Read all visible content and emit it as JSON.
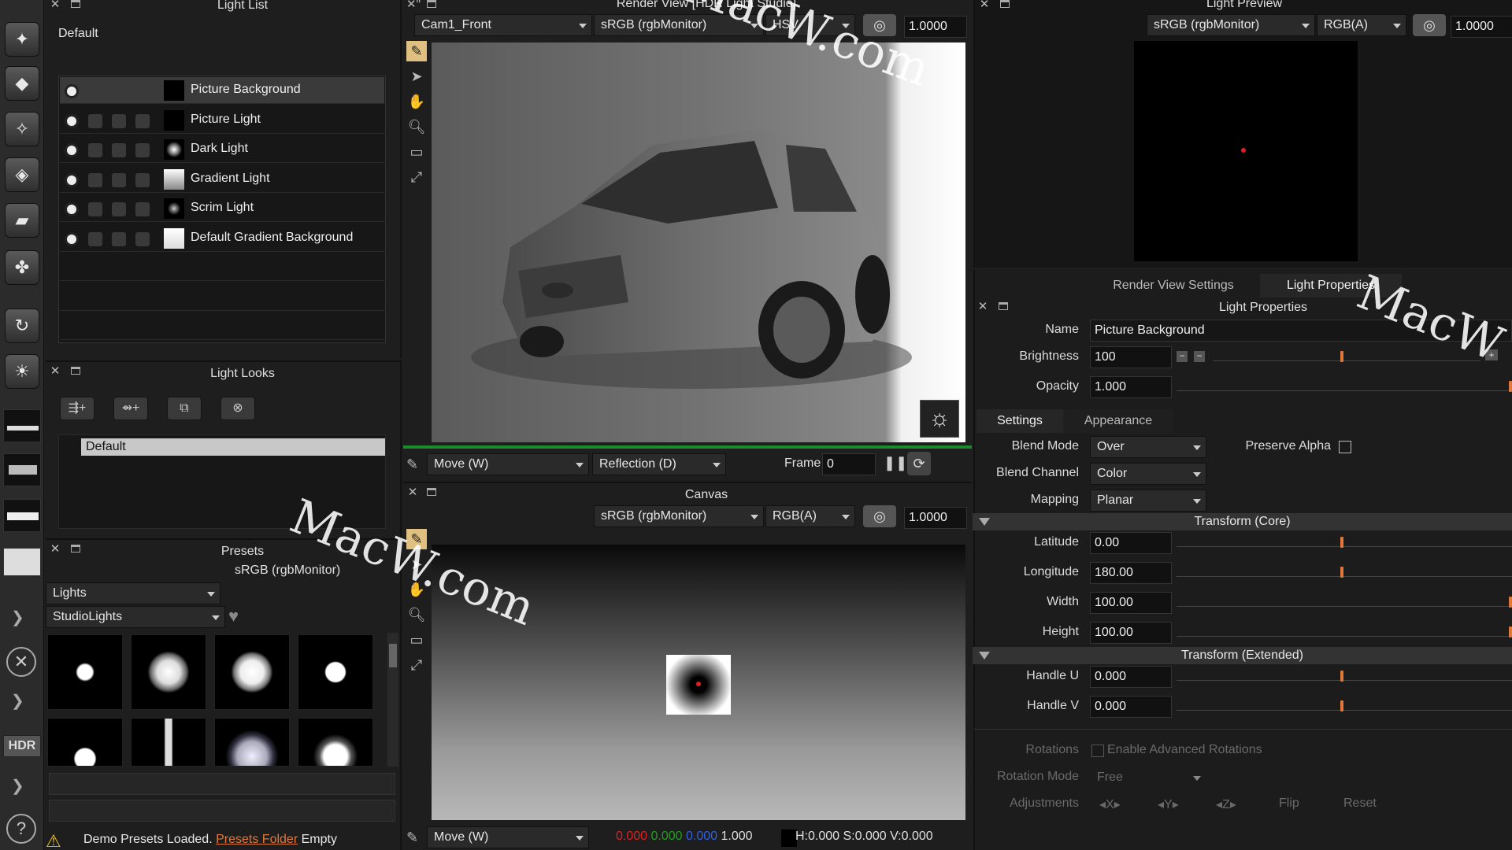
{
  "light_list": {
    "title": "Light List",
    "group": "Default",
    "items": [
      {
        "name": "Picture Background",
        "thumb": "black",
        "selected": true
      },
      {
        "name": "Picture Light",
        "thumb": "black"
      },
      {
        "name": "Dark Light",
        "thumb": "radial"
      },
      {
        "name": "Gradient Light",
        "thumb": "gradient"
      },
      {
        "name": "Scrim Light",
        "thumb": "dot"
      },
      {
        "name": "Default Gradient Background",
        "thumb": "white"
      }
    ]
  },
  "light_looks": {
    "title": "Light Looks",
    "item": "Default"
  },
  "presets": {
    "title": "Presets",
    "color_space": "sRGB (rgbMonitor)",
    "category": "Lights",
    "library": "StudioLights",
    "status_text": "Demo Presets Loaded.",
    "status_link": "Presets Folder",
    "status_suffix": "Empty"
  },
  "render_view": {
    "title": "Render View [HDR Light Studio]",
    "camera": "Cam1_Front",
    "color_space": "sRGB (rgbMonitor)",
    "channel": "HSV",
    "exposure": "1.0000",
    "mode": "Move (W)",
    "reflection": "Reflection (D)",
    "frame_label": "Frame",
    "frame_value": "0"
  },
  "canvas": {
    "title": "Canvas",
    "color_space": "sRGB (rgbMonitor)",
    "channel": "RGB(A)",
    "exposure": "1.0000",
    "mode": "Move (W)",
    "readout_r": "0.000",
    "readout_g": "0.000",
    "readout_b": "0.000",
    "readout_a": "1.000",
    "readout_hsv": "H:0.000 S:0.000 V:0.000",
    "colors": {
      "r": "#e02020",
      "g": "#20a020",
      "b": "#3060e0"
    }
  },
  "light_preview": {
    "title": "Light Preview",
    "color_space": "sRGB (rgbMonitor)",
    "channel": "RGB(A)",
    "exposure": "1.0000"
  },
  "properties": {
    "tabs": [
      "Render View Settings",
      "Light Properties"
    ],
    "title": "Light Properties",
    "name_label": "Name",
    "name_value": "Picture Background",
    "brightness_label": "Brightness",
    "brightness_value": "100",
    "opacity_label": "Opacity",
    "opacity_value": "1.000",
    "sub_tabs": [
      "Settings",
      "Appearance"
    ],
    "blend_mode_label": "Blend Mode",
    "blend_mode_value": "Over",
    "preserve_alpha_label": "Preserve Alpha",
    "blend_channel_label": "Blend Channel",
    "blend_channel_value": "Color",
    "mapping_label": "Mapping",
    "mapping_value": "Planar",
    "transform_core_title": "Transform (Core)",
    "latitude_label": "Latitude",
    "latitude_value": "0.00",
    "longitude_label": "Longitude",
    "longitude_value": "180.00",
    "width_label": "Width",
    "width_value": "100.00",
    "height_label": "Height",
    "height_value": "100.00",
    "transform_ext_title": "Transform (Extended)",
    "handle_u_label": "Handle U",
    "handle_u_value": "0.000",
    "handle_v_label": "Handle V",
    "handle_v_value": "0.000",
    "rotations_label": "Rotations",
    "enable_rotations_label": "Enable Advanced Rotations",
    "rotation_mode_label": "Rotation Mode",
    "rotation_mode_value": "Free",
    "adjustments_label": "Adjustments",
    "adj_x": "X",
    "adj_y": "Y",
    "adj_z": "Z",
    "flip_label": "Flip",
    "reset_label": "Reset"
  },
  "sidebar": {
    "hdr_label": "HDR",
    "help_label": "?"
  },
  "watermarks": [
    "MacW.com",
    "MacW.com",
    "MacW"
  ],
  "accent": "#e0783a"
}
